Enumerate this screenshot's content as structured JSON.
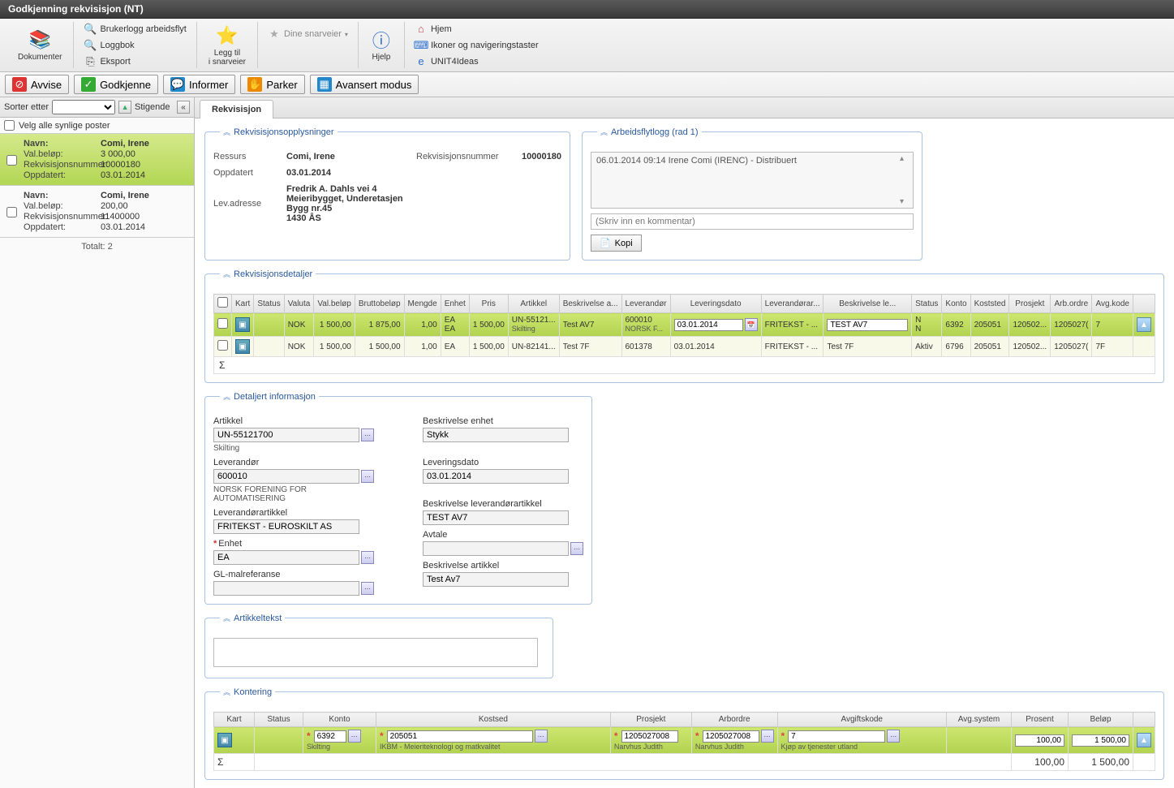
{
  "window": {
    "title": "Godkjenning rekvisisjon (NT)"
  },
  "ribbon": {
    "dokumenter": "Dokumenter",
    "brukerlogg": "Brukerlogg arbeidsflyt",
    "loggbok": "Loggbok",
    "eksport": "Eksport",
    "leggtil": "Legg til\ni snarveier",
    "dine": "Dine snarveier",
    "hjelp": "Hjelp",
    "hjem": "Hjem",
    "ikoner": "Ikoner og navigeringstaster",
    "unit4": "UNIT4Ideas"
  },
  "actions": {
    "avvise": "Avvise",
    "godkjenne": "Godkjenne",
    "informer": "Informer",
    "parker": "Parker",
    "avansert": "Avansert modus"
  },
  "sort": {
    "label": "Sorter etter",
    "dir": "Stigende",
    "collapse": "«"
  },
  "selectall": "Velg alle synlige poster",
  "cards": [
    {
      "navn_lbl": "Navn:",
      "navn": "Comi, Irene",
      "val_lbl": "Val.beløp:",
      "val": "3 000,00",
      "rek_lbl": "Rekvisisjonsnummer:",
      "rek": "10000180",
      "opp_lbl": "Oppdatert:",
      "opp": "03.01.2014"
    },
    {
      "navn_lbl": "Navn:",
      "navn": "Comi, Irene",
      "val_lbl": "Val.beløp:",
      "val": "200,00",
      "rek_lbl": "Rekvisisjonsnummer:",
      "rek": "11400000",
      "opp_lbl": "Oppdatert:",
      "opp": "03.01.2014"
    }
  ],
  "totalt": "Totalt: 2",
  "tab": "Rekvisisjon",
  "panels": {
    "opplysninger": "Rekvisisjonsopplysninger",
    "logg": "Arbeidsflytlogg (rad 1)",
    "detaljer": "Rekvisisjonsdetaljer",
    "detaljert": "Detaljert informasjon",
    "artikkeltekst": "Artikkeltekst",
    "kontering": "Kontering"
  },
  "info": {
    "ressurs_k": "Ressurs",
    "ressurs_v": "Comi, Irene",
    "reknum_k": "Rekvisisjonsnummer",
    "reknum_v": "10000180",
    "oppdatert_k": "Oppdatert",
    "oppdatert_v": "03.01.2014",
    "lev_k": "Lev.adresse",
    "lev_v": "Fredrik A. Dahls vei 4\nMeieribygget, Underetasjen\nBygg nr.45\n1430 ÅS"
  },
  "log": {
    "entry": "06.01.2014 09:14 Irene Comi (IRENC) - Distribuert",
    "comment_ph": "(Skriv inn en kommentar)",
    "kopi": "Kopi"
  },
  "detaljer_cols": [
    "",
    "Kart",
    "Status",
    "Valuta",
    "Val.beløp",
    "Bruttobeløp",
    "Mengde",
    "Enhet",
    "Pris",
    "Artikkel",
    "Beskrivelse a...",
    "Leverandør",
    "Leveringsdato",
    "Leverandørar...",
    "Beskrivelse le...",
    "Status",
    "Konto",
    "Koststed",
    "Prosjekt",
    "Arb.ordre",
    "Avg.kode",
    ""
  ],
  "detaljer_rows": [
    {
      "valuta": "NOK",
      "valbel": "1 500,00",
      "brutto": "1 875,00",
      "mengde": "1,00",
      "enhet": "EA",
      "enhet2": "EA",
      "pris": "1 500,00",
      "art": "UN-55121...",
      "art_sub": "Skilting",
      "besk": "Test AV7",
      "lev": "600010",
      "lev_sub": "NORSK F...",
      "levdato": "03.01.2014",
      "levart": "FRITEKST - ...",
      "besklev": "TEST AV7",
      "status": "N",
      "status2": "N",
      "konto": "6392",
      "kostsed": "205051",
      "prosjekt": "120502...",
      "arb": "1205027(",
      "avg": "7"
    },
    {
      "valuta": "NOK",
      "valbel": "1 500,00",
      "brutto": "1 500,00",
      "mengde": "1,00",
      "enhet": "EA",
      "pris": "1 500,00",
      "art": "UN-82141...",
      "besk": "Test 7F",
      "lev": "601378",
      "levdato": "03.01.2014",
      "levart": "FRITEKST - ...",
      "besklev": "Test 7F",
      "status": "Aktiv",
      "konto": "6796",
      "kostsed": "205051",
      "prosjekt": "120502...",
      "arb": "1205027(",
      "avg": "7F"
    }
  ],
  "sum_symbol": "Σ",
  "detform": {
    "artikkel_l": "Artikkel",
    "artikkel_v": "UN-55121700",
    "artikkel_sub": "Skilting",
    "lev_l": "Leverandør",
    "lev_v": "600010",
    "lev_sub": "NORSK FORENING FOR AUTOMATISERING",
    "levart_l": "Leverandørartikkel",
    "levart_v": "FRITEKST - EUROSKILT AS",
    "enhet_l": "Enhet",
    "enhet_v": "EA",
    "glmal_l": "GL-malreferanse",
    "glmal_v": "",
    "beenh_l": "Beskrivelse enhet",
    "beenh_v": "Stykk",
    "levdato_l": "Leveringsdato",
    "levdato_v": "03.01.2014",
    "belevart_l": "Beskrivelse leverandørartikkel",
    "belevart_v": "TEST AV7",
    "avtale_l": "Avtale",
    "avtale_v": "",
    "beart_l": "Beskrivelse artikkel",
    "beart_v": "Test Av7"
  },
  "kont_cols": [
    "Kart",
    "Status",
    "Konto",
    "Kostsed",
    "Prosjekt",
    "Arbordre",
    "Avgiftskode",
    "Avg.system",
    "Prosent",
    "Beløp",
    ""
  ],
  "kont_row": {
    "konto": "6392",
    "konto_sub": "Skilting",
    "kost": "205051",
    "kost_sub": "IKBM - Meieriteknologi og matkvalitet",
    "pros": "1205027008",
    "pros_sub": "Narvhus Judith",
    "arb": "1205027008",
    "arb_sub": "Narvhus Judith",
    "avg": "7",
    "avg_sub": "Kjøp av tjenester utland",
    "prosent": "100,00",
    "belop": "1 500,00"
  },
  "kont_sum": {
    "prosent": "100,00",
    "belop": "1 500,00"
  }
}
